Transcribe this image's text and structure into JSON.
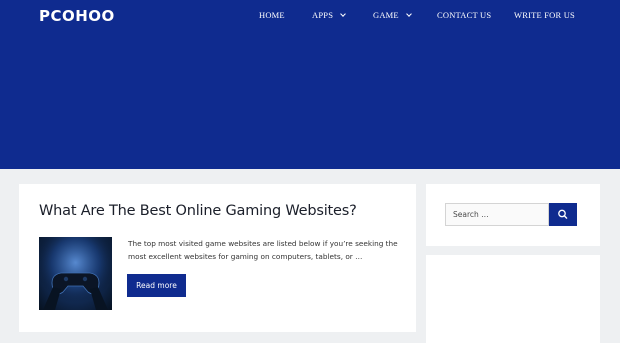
{
  "site": {
    "logo": "PCOHOO"
  },
  "nav": {
    "items": [
      {
        "label": "HOME",
        "has_dropdown": false
      },
      {
        "label": "APPS",
        "has_dropdown": true
      },
      {
        "label": "GAME",
        "has_dropdown": true
      },
      {
        "label": "CONTACT US",
        "has_dropdown": false
      },
      {
        "label": "WRITE FOR US",
        "has_dropdown": false
      }
    ]
  },
  "post": {
    "title": "What Are The Best Online Gaming Websites?",
    "excerpt_line1": "The top most visited game websites are listed below if you’re seeking the",
    "excerpt_line2": "most excellent websites for gaming on computers, tablets, or …",
    "read_more": "Read more",
    "thumbnail_icon": "gamepad-controller-icon"
  },
  "sidebar": {
    "search": {
      "placeholder": "Search …",
      "button_icon": "search-icon"
    }
  },
  "colors": {
    "header_bg": "#0f2b8f",
    "accent": "#0f2b8f",
    "page_bg": "#eef0f2",
    "card_bg": "#ffffff"
  }
}
